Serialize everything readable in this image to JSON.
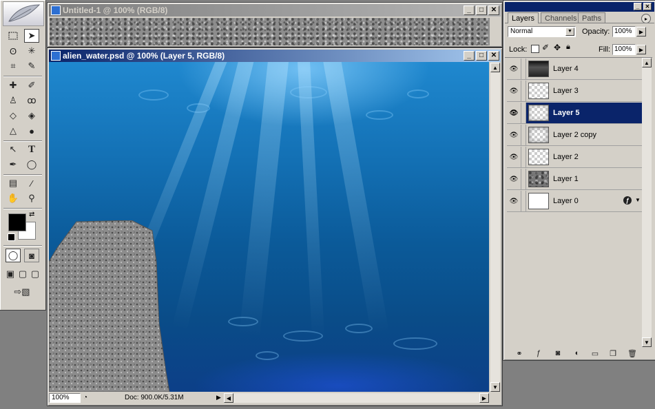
{
  "doc_windows": [
    {
      "title": "Untitled-1 @ 100% (RGB/8)",
      "state": "inactive"
    },
    {
      "title": "alien_water.psd @ 100% (Layer 5, RGB/8)",
      "state": "active"
    }
  ],
  "window_buttons": {
    "minimize": "_",
    "maximize": "□",
    "close": "✕"
  },
  "status_bar": {
    "zoom": "100%",
    "doc_info": "Doc: 900.0K/5.31M"
  },
  "layers_palette": {
    "tabs": [
      "Layers",
      "Channels",
      "Paths"
    ],
    "active_tab": "Layers",
    "blend_mode": "Normal",
    "opacity_label": "Opacity:",
    "opacity": "100%",
    "lock_label": "Lock:",
    "fill_label": "Fill:",
    "fill": "100%",
    "layers": [
      {
        "name": "Layer 4",
        "thumb": "dark-top",
        "selected": false
      },
      {
        "name": "Layer 3",
        "thumb": "transparent",
        "selected": false
      },
      {
        "name": "Layer 5",
        "thumb": "transparent-soft",
        "selected": true
      },
      {
        "name": "Layer 2 copy",
        "thumb": "transparent-gray",
        "selected": false
      },
      {
        "name": "Layer 2",
        "thumb": "transparent",
        "selected": false
      },
      {
        "name": "Layer 1",
        "thumb": "gray-texture",
        "selected": false
      },
      {
        "name": "Layer 0",
        "thumb": "white",
        "selected": false,
        "has_effects": true
      }
    ]
  },
  "colors": {
    "foreground": "#000000",
    "background": "#ffffff",
    "title_active": "#0a246a",
    "selection": "#0a246a"
  }
}
